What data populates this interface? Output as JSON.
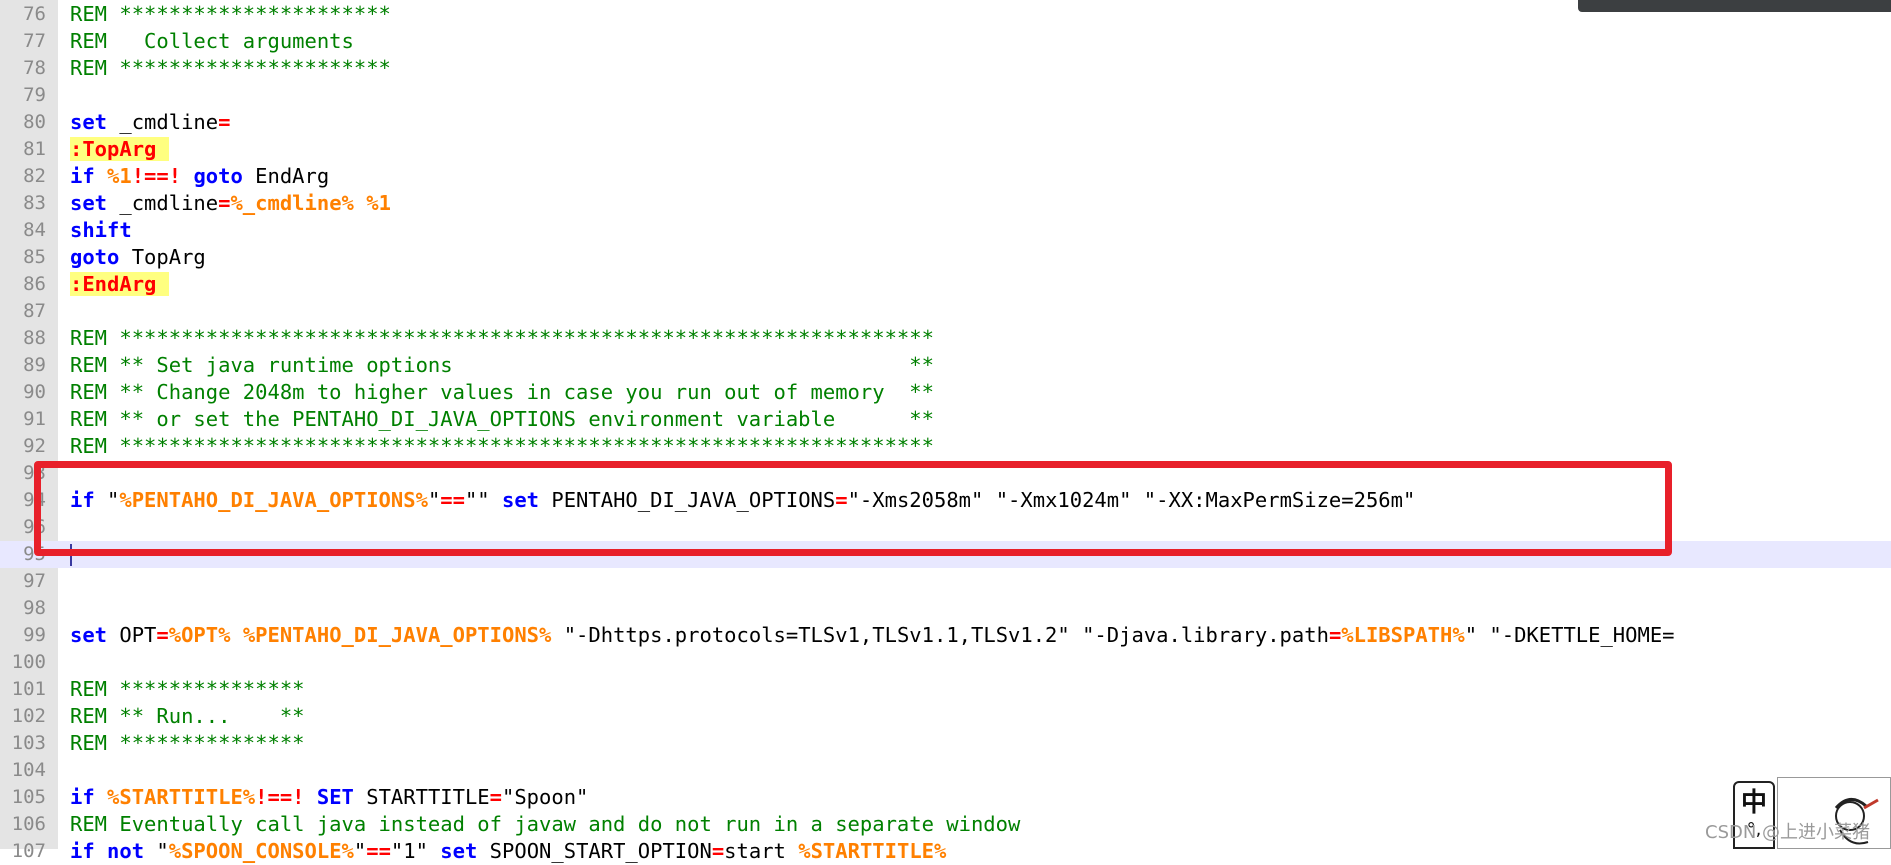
{
  "editor": {
    "lines": [
      {
        "n": "76",
        "parts": [
          [
            "rem",
            "REM **********************"
          ]
        ]
      },
      {
        "n": "77",
        "parts": [
          [
            "rem",
            "REM   Collect arguments"
          ]
        ]
      },
      {
        "n": "78",
        "parts": [
          [
            "rem",
            "REM **********************"
          ]
        ]
      },
      {
        "n": "79",
        "parts": []
      },
      {
        "n": "80",
        "parts": [
          [
            "kw",
            "set"
          ],
          [
            "txt",
            " _cmdline"
          ],
          [
            "op",
            "="
          ]
        ]
      },
      {
        "n": "81",
        "parts": [
          [
            "label",
            ":TopArg "
          ]
        ]
      },
      {
        "n": "82",
        "parts": [
          [
            "kw",
            "if"
          ],
          [
            "txt",
            " "
          ],
          [
            "var",
            "%1"
          ],
          [
            "op",
            "!==!"
          ],
          [
            "txt",
            " "
          ],
          [
            "kw",
            "goto"
          ],
          [
            "txt",
            " EndArg"
          ]
        ]
      },
      {
        "n": "83",
        "parts": [
          [
            "kw",
            "set"
          ],
          [
            "txt",
            " _cmdline"
          ],
          [
            "op",
            "="
          ],
          [
            "var",
            "%_cmdline%"
          ],
          [
            "txt",
            " "
          ],
          [
            "var",
            "%1"
          ]
        ]
      },
      {
        "n": "84",
        "parts": [
          [
            "kw",
            "shift"
          ]
        ]
      },
      {
        "n": "85",
        "parts": [
          [
            "kw",
            "goto"
          ],
          [
            "txt",
            " TopArg"
          ]
        ]
      },
      {
        "n": "86",
        "parts": [
          [
            "label",
            ":EndArg "
          ]
        ]
      },
      {
        "n": "87",
        "parts": []
      },
      {
        "n": "88",
        "parts": [
          [
            "rem",
            "REM ******************************************************************"
          ]
        ]
      },
      {
        "n": "89",
        "parts": [
          [
            "rem",
            "REM ** Set java runtime options                                     **"
          ]
        ]
      },
      {
        "n": "90",
        "parts": [
          [
            "rem",
            "REM ** Change 2048m to higher values in case you run out of memory  **"
          ]
        ]
      },
      {
        "n": "91",
        "parts": [
          [
            "rem",
            "REM ** or set the PENTAHO_DI_JAVA_OPTIONS environment variable      **"
          ]
        ]
      },
      {
        "n": "92",
        "parts": [
          [
            "rem",
            "REM ******************************************************************"
          ]
        ]
      },
      {
        "n": "93",
        "parts": []
      },
      {
        "n": "94",
        "parts": [
          [
            "kw",
            "if"
          ],
          [
            "txt",
            " \""
          ],
          [
            "var",
            "%PENTAHO_DI_JAVA_OPTIONS%"
          ],
          [
            "txt",
            "\""
          ],
          [
            "op",
            "=="
          ],
          [
            "txt",
            "\"\" "
          ],
          [
            "kw",
            "set"
          ],
          [
            "txt",
            " PENTAHO_DI_JAVA_OPTIONS"
          ],
          [
            "op",
            "="
          ],
          [
            "txt",
            "\"-Xms2058m\" \"-Xmx1024m\" \"-XX:MaxPermSize=256m\""
          ]
        ]
      },
      {
        "n": "96",
        "parts": []
      },
      {
        "n": "95",
        "parts": [],
        "current": true
      },
      {
        "n": "97",
        "parts": []
      },
      {
        "n": "98",
        "parts": []
      },
      {
        "n": "99",
        "parts": [
          [
            "kw",
            "set"
          ],
          [
            "txt",
            " OPT"
          ],
          [
            "op",
            "="
          ],
          [
            "var",
            "%OPT%"
          ],
          [
            "txt",
            " "
          ],
          [
            "var",
            "%PENTAHO_DI_JAVA_OPTIONS%"
          ],
          [
            "txt",
            " \"-Dhttps.protocols=TLSv1,TLSv1.1,TLSv1.2\" \"-Djava.library.path"
          ],
          [
            "op",
            "="
          ],
          [
            "var",
            "%LIBSPATH%"
          ],
          [
            "txt",
            "\" \"-DKETTLE_HOME="
          ]
        ]
      },
      {
        "n": "100",
        "parts": []
      },
      {
        "n": "101",
        "parts": [
          [
            "rem",
            "REM ***************"
          ]
        ]
      },
      {
        "n": "102",
        "parts": [
          [
            "rem",
            "REM ** Run...    **"
          ]
        ]
      },
      {
        "n": "103",
        "parts": [
          [
            "rem",
            "REM ***************"
          ]
        ]
      },
      {
        "n": "104",
        "parts": []
      },
      {
        "n": "105",
        "parts": [
          [
            "kw",
            "if"
          ],
          [
            "txt",
            " "
          ],
          [
            "var",
            "%STARTTITLE%"
          ],
          [
            "op",
            "!==!"
          ],
          [
            "txt",
            " "
          ],
          [
            "kw",
            "SET"
          ],
          [
            "txt",
            " STARTTITLE"
          ],
          [
            "op",
            "="
          ],
          [
            "txt",
            "\"Spoon\""
          ]
        ]
      },
      {
        "n": "106",
        "parts": [
          [
            "rem",
            "REM Eventually call java instead of javaw and do not run in a separate window"
          ]
        ]
      },
      {
        "n": "107",
        "parts": [
          [
            "kw",
            "if"
          ],
          [
            "txt",
            " "
          ],
          [
            "kw",
            "not"
          ],
          [
            "txt",
            " \""
          ],
          [
            "var",
            "%SPOON_CONSOLE%"
          ],
          [
            "txt",
            "\""
          ],
          [
            "op",
            "=="
          ],
          [
            "txt",
            "\"1\" "
          ],
          [
            "kw",
            "set"
          ],
          [
            "txt",
            " SPOON_START_OPTION"
          ],
          [
            "op",
            "="
          ],
          [
            "txt",
            "start "
          ],
          [
            "var",
            "%STARTTITLE%"
          ]
        ]
      }
    ]
  },
  "ime": {
    "char": "中",
    "dots": "°,"
  },
  "watermark": "CSDN @上进小菜猪"
}
